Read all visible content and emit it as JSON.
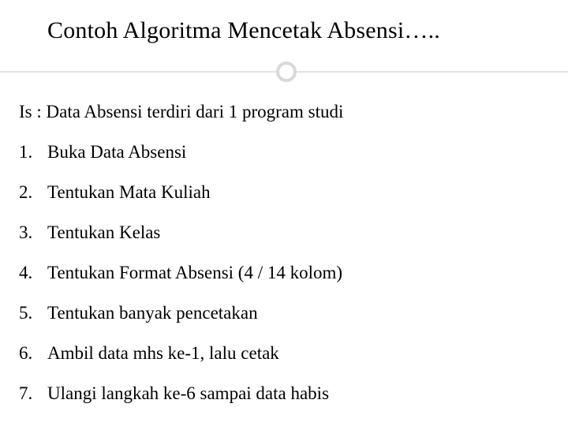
{
  "title": "Contoh Algoritma Mencetak Absensi…..",
  "intro": "Is : Data Absensi terdiri dari 1 program studi",
  "steps": [
    "Buka Data Absensi",
    "Tentukan Mata Kuliah",
    "Tentukan Kelas",
    "Tentukan Format Absensi (4 / 14 kolom)",
    "Tentukan banyak pencetakan",
    "Ambil data mhs ke-1, lalu cetak",
    "Ulangi langkah ke-6  sampai data habis"
  ]
}
